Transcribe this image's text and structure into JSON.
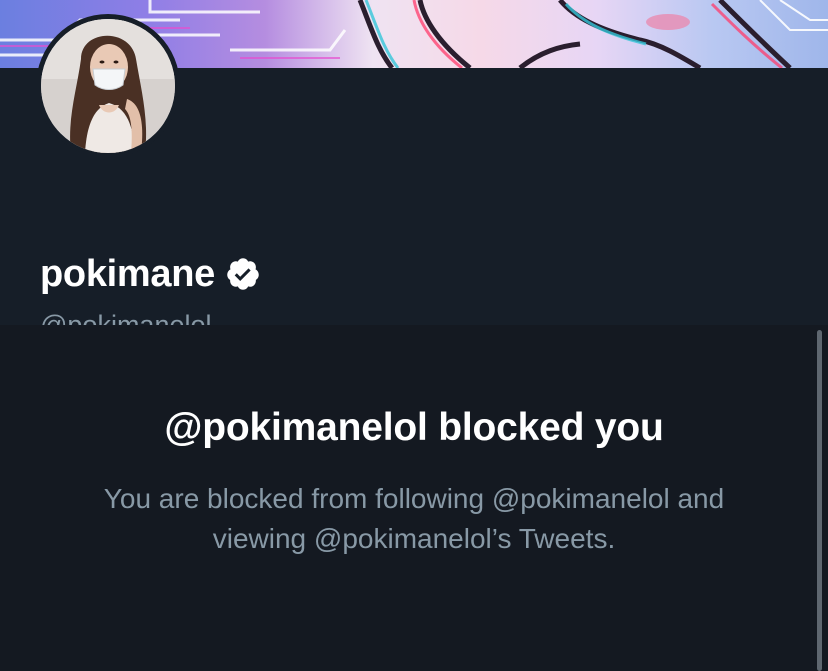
{
  "profile": {
    "display_name": "pokimane",
    "handle": "@pokimanelol",
    "verified": true,
    "verified_icon": "verified-badge-icon"
  },
  "blocked": {
    "title": "@pokimanelol blocked you",
    "message": "You are blocked from following @pokimanelol and viewing @pokimanelol’s Tweets."
  },
  "colors": {
    "header_bg": "#161e28",
    "content_bg": "#141921",
    "primary_text": "#ffffff",
    "secondary_text": "#8899a6"
  }
}
